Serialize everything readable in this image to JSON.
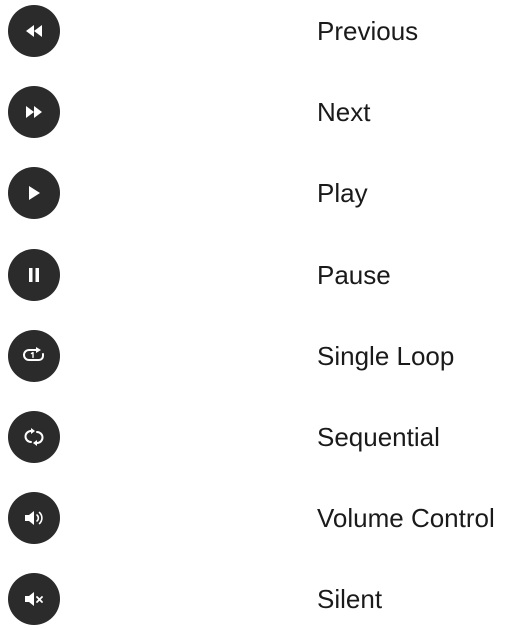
{
  "controls": [
    {
      "label": "Previous",
      "icon": "rewind-icon"
    },
    {
      "label": "Next",
      "icon": "fast-forward-icon"
    },
    {
      "label": "Play",
      "icon": "play-icon"
    },
    {
      "label": "Pause",
      "icon": "pause-icon"
    },
    {
      "label": "Single Loop",
      "icon": "repeat-one-icon"
    },
    {
      "label": "Sequential",
      "icon": "repeat-icon"
    },
    {
      "label": "Volume Control",
      "icon": "volume-icon"
    },
    {
      "label": "Silent",
      "icon": "mute-icon"
    }
  ],
  "colors": {
    "button_background": "#2b2b2b",
    "icon_color": "#ffffff",
    "label_color": "#1a1a1a",
    "page_background": "#ffffff"
  }
}
